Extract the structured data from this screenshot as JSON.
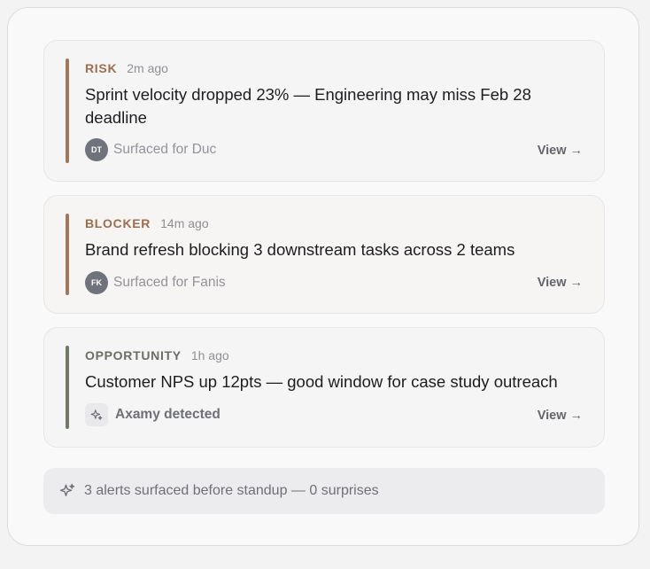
{
  "alerts": [
    {
      "kind": "RISK",
      "kind_color": "#9b6e4e",
      "accent_color": "#a0785a",
      "time": "2m ago",
      "title": "Sprint velocity dropped 23% — Engineering may miss Feb 28 deadline",
      "source_type": "avatar",
      "avatar_initials": "DT",
      "source_text": "Surfaced for Duc",
      "view_label": "View",
      "view_arrow": "→"
    },
    {
      "kind": "BLOCKER",
      "kind_color": "#9b6e4e",
      "accent_color": "#a0785a",
      "time": "14m ago",
      "title": "Brand refresh blocking 3 downstream tasks across 2 teams",
      "source_type": "avatar",
      "avatar_initials": "FK",
      "source_text": "Surfaced for Fanis",
      "view_label": "View",
      "view_arrow": "→"
    },
    {
      "kind": "OPPORTUNITY",
      "kind_color": "#6b6d66",
      "accent_color": "#6f7a66",
      "time": "1h ago",
      "title": "Customer NPS up 12pts — good window for case study outreach",
      "source_type": "ai",
      "source_icon": "sparkle-icon",
      "source_text": "Axamy detected",
      "view_label": "View",
      "view_arrow": "→"
    }
  ],
  "footer": {
    "icon": "sparkle-icon",
    "text": "3 alerts surfaced before standup — 0 surprises"
  }
}
